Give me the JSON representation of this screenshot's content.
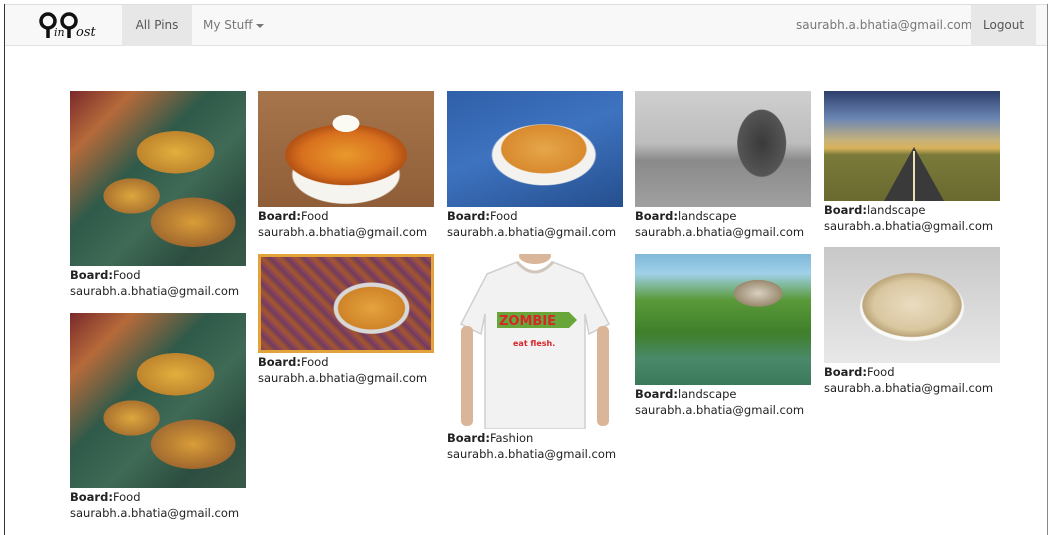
{
  "nav": {
    "brand": "PinPost",
    "all_pins": "All Pins",
    "my_stuff": "My Stuff",
    "user_email": "saurabh.a.bhatia@gmail.com",
    "logout": "Logout"
  },
  "board_label": "Board:",
  "tshirt_text": {
    "line1": "ZOMBIE",
    "line2": "eat flesh."
  },
  "pins": [
    {
      "board": "Food",
      "user": "saurabh.a.bhatia@gmail.com"
    },
    {
      "board": "Food",
      "user": "saurabh.a.bhatia@gmail.com"
    },
    {
      "board": "Food",
      "user": "saurabh.a.bhatia@gmail.com"
    },
    {
      "board": "Food",
      "user": "saurabh.a.bhatia@gmail.com"
    },
    {
      "board": "Food",
      "user": "saurabh.a.bhatia@gmail.com"
    },
    {
      "board": "Fashion",
      "user": "saurabh.a.bhatia@gmail.com"
    },
    {
      "board": "landscape",
      "user": "saurabh.a.bhatia@gmail.com"
    },
    {
      "board": "landscape",
      "user": "saurabh.a.bhatia@gmail.com"
    },
    {
      "board": "landscape",
      "user": "saurabh.a.bhatia@gmail.com"
    },
    {
      "board": "Food",
      "user": "saurabh.a.bhatia@gmail.com"
    }
  ]
}
